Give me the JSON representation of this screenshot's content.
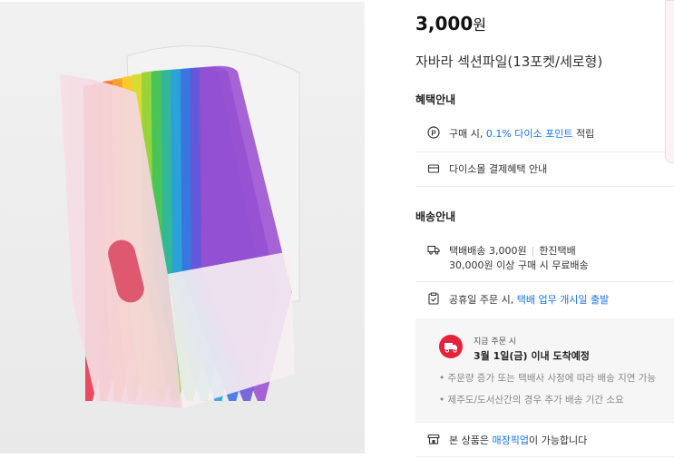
{
  "product": {
    "price_value": "3,000",
    "price_unit": "원",
    "title": "자바라 섹션파일(13포켓/세로형)",
    "image_icon": "rainbow-expanding-file-photo"
  },
  "benefits": {
    "heading": "혜택안내",
    "point_pre": "구매 시, ",
    "point_link": "0.1% 다이소 포인트",
    "point_post": " 적립",
    "card": "다이소몰 결제혜택 안내"
  },
  "shipping": {
    "heading": "배송안내",
    "method": "택배배송 3,000원",
    "carrier": "한진택배",
    "free_condition": "30,000원 이상 구매 시 무료배송",
    "holiday_pre": "공휴일 주문 시, ",
    "holiday_link": "택배 업무 개시일 출발",
    "now_label": "지금 주문 시",
    "eta": "3월 1일(금) 이내 도착예정",
    "notes": [
      "• 주문량 증가 또는 택배사 사정에 따라 배송 지연 가능",
      "• 제주도/도서산간의 경우 추가 배송 기간 소요"
    ],
    "pickup_pre": "본 상품은 ",
    "pickup_link": "매장픽업",
    "pickup_post": "이 가능합니다"
  },
  "colors": {
    "accent_blue": "#1a73e8",
    "badge_red": "#e5213b"
  }
}
